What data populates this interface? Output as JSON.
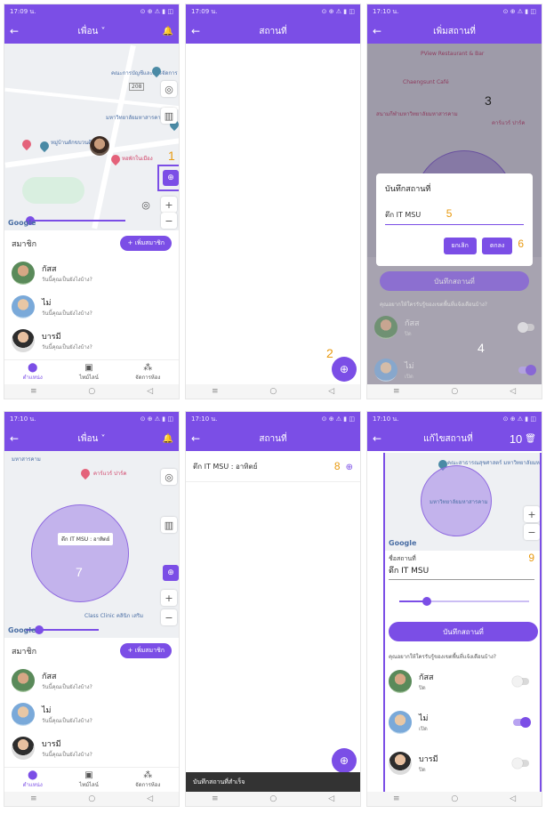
{
  "status": {
    "time1": "17:09 น.",
    "time2": "17:10 น.",
    "icons": "⊙ ⊕ ⚠ ▮ ◫"
  },
  "nav": {
    "friends_title": "เพื่อน",
    "places_title": "สถานที่",
    "add_place_title": "เพิ่มสถานที่",
    "edit_place_title": "แก้ไขสถานที่"
  },
  "map": {
    "label_faculty_accounting": "คณะการบัญชีและการจัดการ",
    "label_msu": "มหาวิทยาลัยมหาสารคาม",
    "label_village": "หมู่บ้านดักขบวนดี",
    "label_dorm": "หอพักในเมือง",
    "label_pview": "PView Restaurant & Bar",
    "label_chaengsunt": "Chaengsunt Café",
    "label_msu_stadium": "สนามกีฬามหาวิทยาลัยมหาสารคาม",
    "label_caraward": "คาร์แวร์ ปาร์ค",
    "label_tag": "ตึก IT MSU : อาทิตย์",
    "label_class_clinic": "Class Clinic คลินิก เสริม",
    "label_faculty_public_health": "คณะสาธารณสุขศาสตร์ มหาวิทยาลัยมหาสารคาม",
    "label_mahasarakham": "มหาสารคาม",
    "google": "Google",
    "road_208": "208"
  },
  "members": {
    "title": "สมาชิก",
    "add_button": "เพิ่มสมาชิก",
    "list": [
      {
        "name": "กัสส",
        "status": "วันนี้คุณเป็นยังไงบ้าง?"
      },
      {
        "name": "ไม่",
        "status": "วันนี้คุณเป็นยังไงบ้าง?"
      },
      {
        "name": "บารมี",
        "status": "วันนี้คุณเป็นยังไงบ้าง?"
      }
    ]
  },
  "bottom_nav": {
    "location": "ตำแหน่ง",
    "timeline": "ไทม์ไลน์",
    "manage_rooms": "จัดการห้อง"
  },
  "dialog": {
    "title": "บันทึกสถานที่",
    "input_value": "ตึก IT MSU",
    "cancel": "ยกเลิก",
    "ok": "ตกลง"
  },
  "save_place_button": "บันทึกสถานที่",
  "notify_question": "คุณอยากให้ใครรับรู้ของเขตพื้นที่แจ้งเตือนบ้าง?",
  "place_row": "ตึก IT MSU : อาทิตย์",
  "snackbar": "บันทึกสถานที่สำเร็จ",
  "edit": {
    "field_label": "ชื่อสถานที่",
    "field_value": "ตึก IT MSU"
  },
  "notify_members": [
    {
      "name": "กัสส",
      "sub": "ปิด",
      "on": false
    },
    {
      "name": "ไม่",
      "sub": "เปิด",
      "on": true
    },
    {
      "name": "บารมี",
      "sub": "ปิด",
      "on": false
    }
  ],
  "steps": [
    "1",
    "2",
    "3",
    "4",
    "5",
    "6",
    "7",
    "8",
    "9",
    "10"
  ],
  "sysnav": {
    "menu": "≡",
    "home": "○",
    "back": "◁"
  },
  "colors": {
    "primary": "#7b4ee6",
    "step_marker": "#e89a10"
  }
}
